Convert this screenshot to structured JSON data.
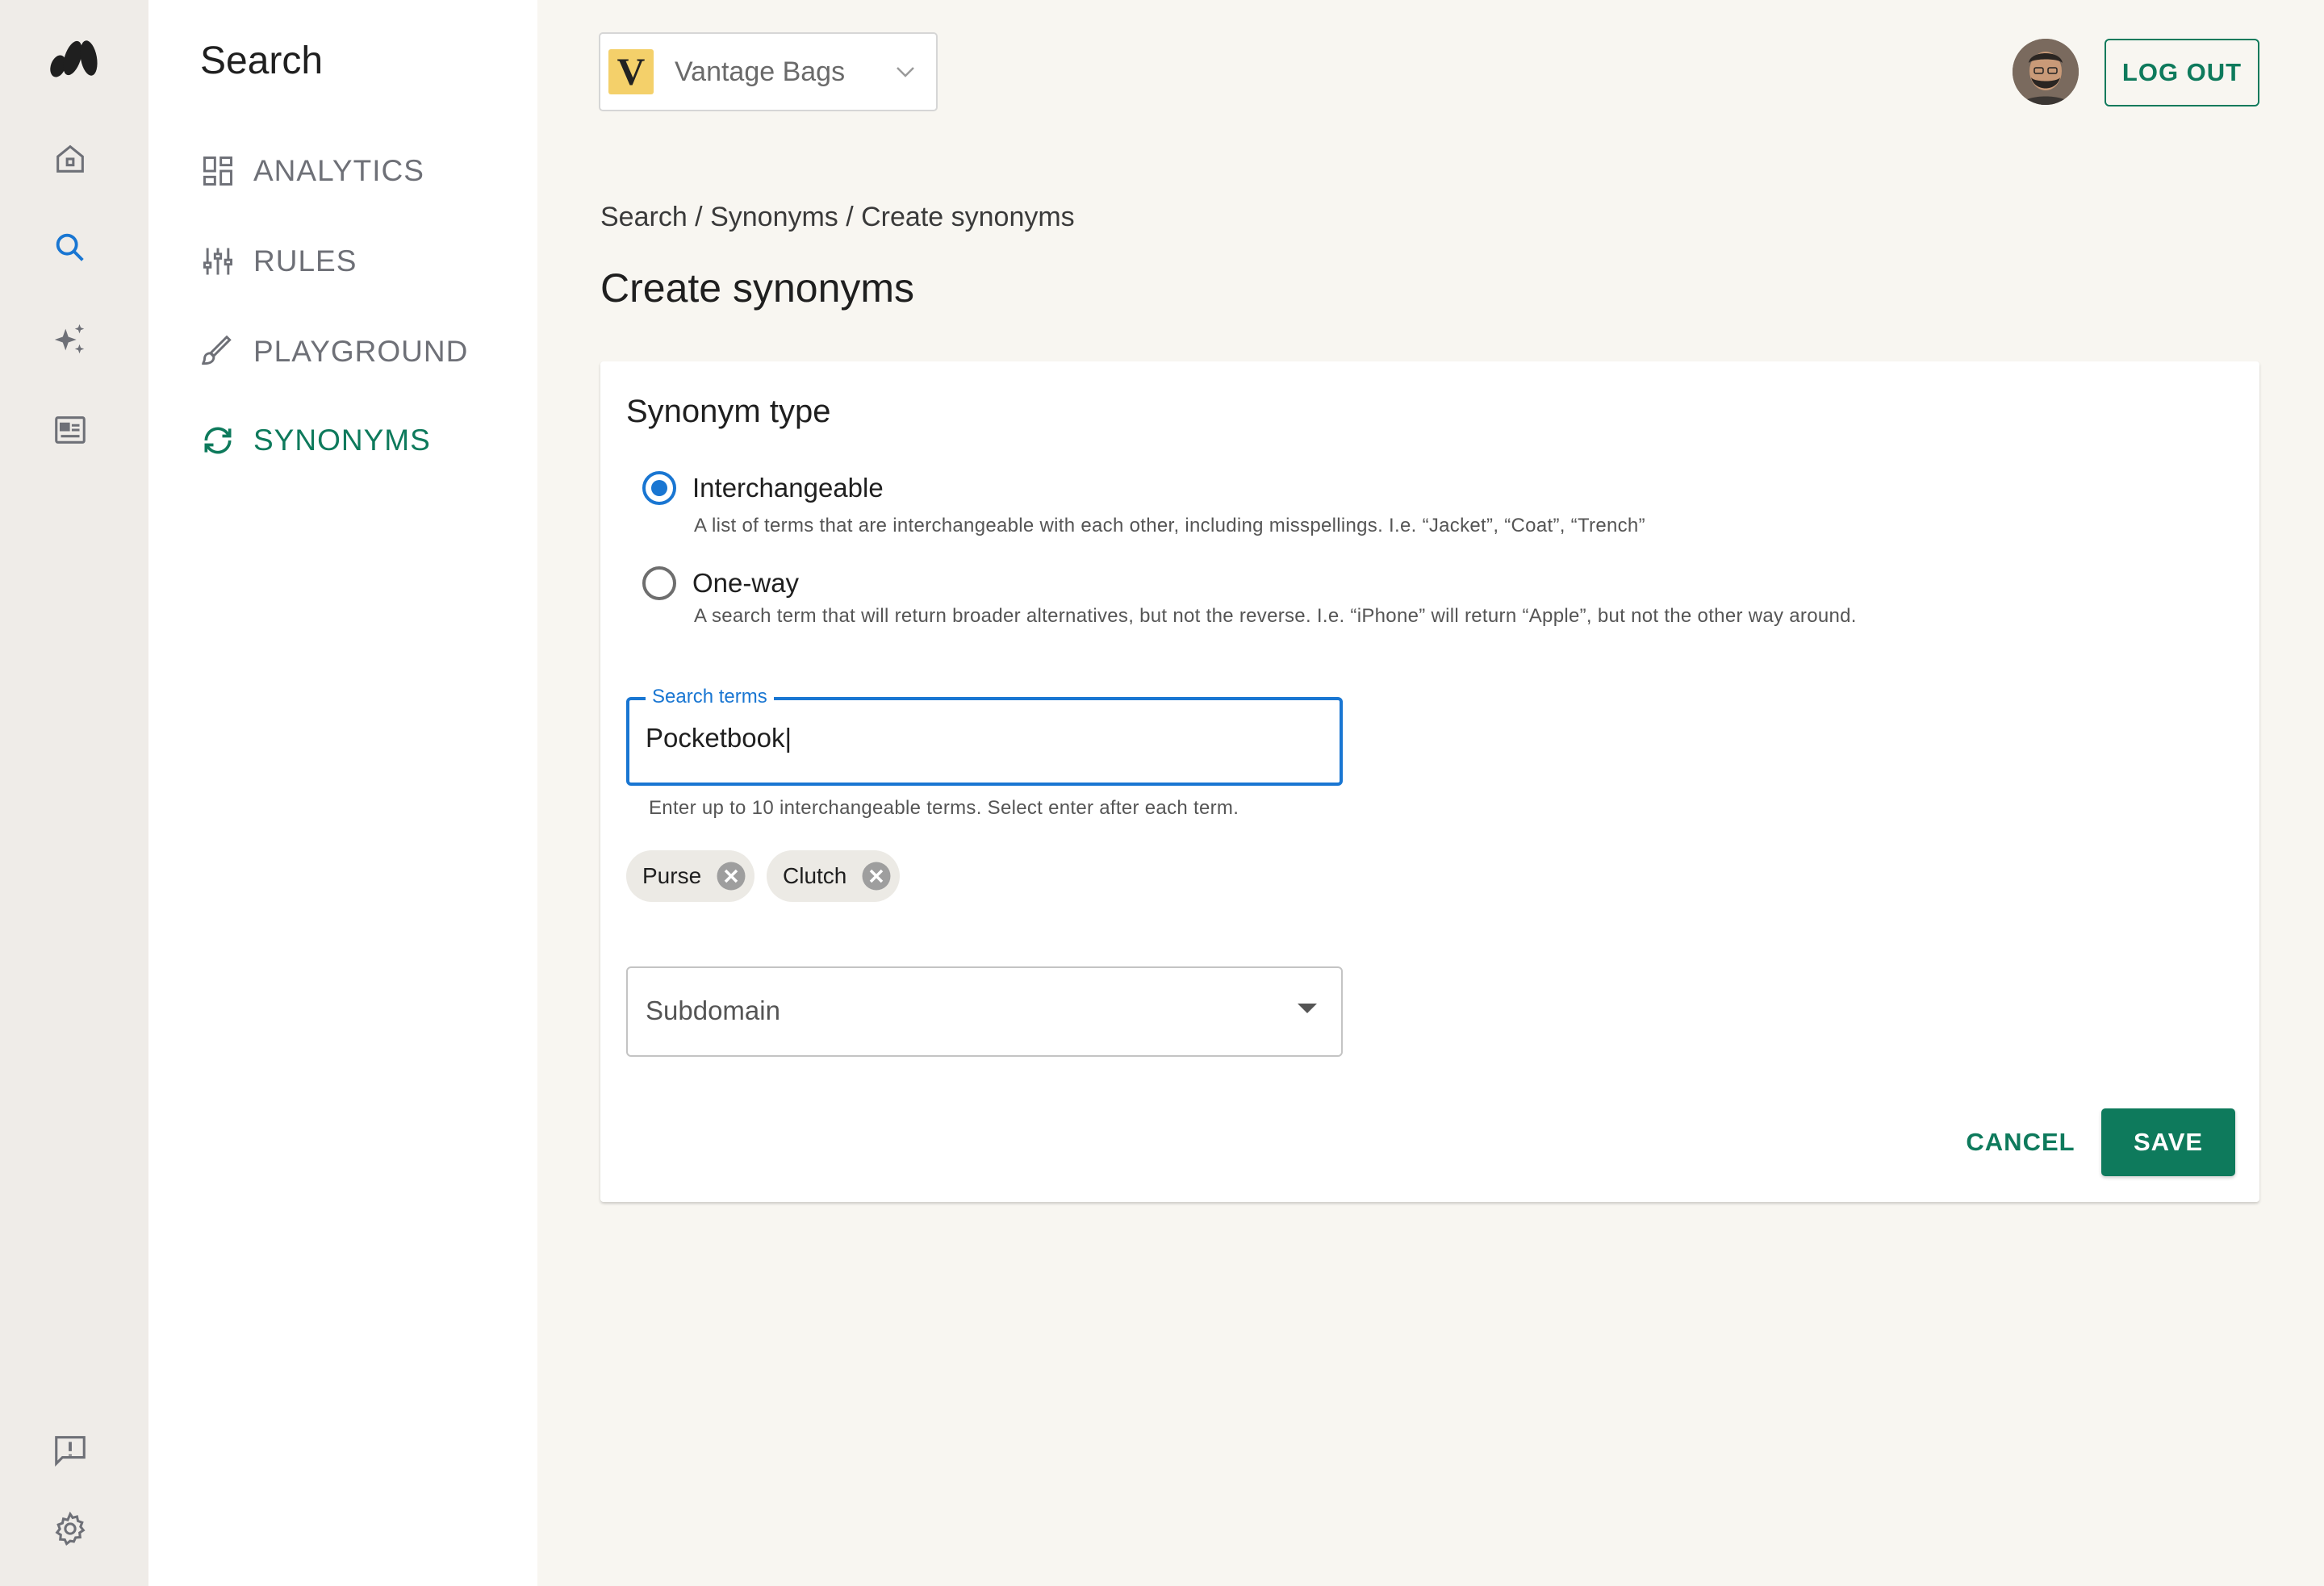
{
  "rail": {
    "icons": [
      "logo-icon",
      "home-icon",
      "search-icon",
      "sparkle-icon",
      "article-icon",
      "feedback-icon",
      "gear-icon"
    ],
    "active": "search-icon",
    "active_color": "#1976d2"
  },
  "panel": {
    "title": "Search",
    "items": [
      {
        "label": "ANALYTICS",
        "icon": "dashboard-icon",
        "active": false
      },
      {
        "label": "RULES",
        "icon": "sliders-icon",
        "active": false
      },
      {
        "label": "PLAYGROUND",
        "icon": "brush-icon",
        "active": false
      },
      {
        "label": "SYNONYMS",
        "icon": "sync-icon",
        "active": true
      }
    ]
  },
  "header": {
    "brand_letter": "V",
    "brand_name": "Vantage Bags",
    "logout_label": "LOG OUT"
  },
  "breadcrumb": "Search / Synonyms / Create synonyms",
  "page_title": "Create synonyms",
  "form": {
    "section_title": "Synonym type",
    "options": [
      {
        "label": "Interchangeable",
        "description": "A list of terms that are interchangeable with each other, including misspellings. I.e. “Jacket”, “Coat”, “Trench”",
        "checked": true
      },
      {
        "label": "One-way",
        "description": "A search term that will return broader alternatives, but not the reverse. I.e. “iPhone” will return “Apple”, but not the other way around.",
        "checked": false
      }
    ],
    "search_terms_label": "Search terms",
    "search_terms_value": "Pocketbook|",
    "helper_text": "Enter up to 10 interchangeable terms. Select enter after each term.",
    "chips": [
      "Purse",
      "Clutch"
    ],
    "subdomain_placeholder": "Subdomain",
    "cancel_label": "CANCEL",
    "save_label": "SAVE"
  },
  "colors": {
    "accent_green": "#0e7a5c",
    "accent_blue": "#1976d2",
    "brand_yellow": "#f4d06a"
  }
}
